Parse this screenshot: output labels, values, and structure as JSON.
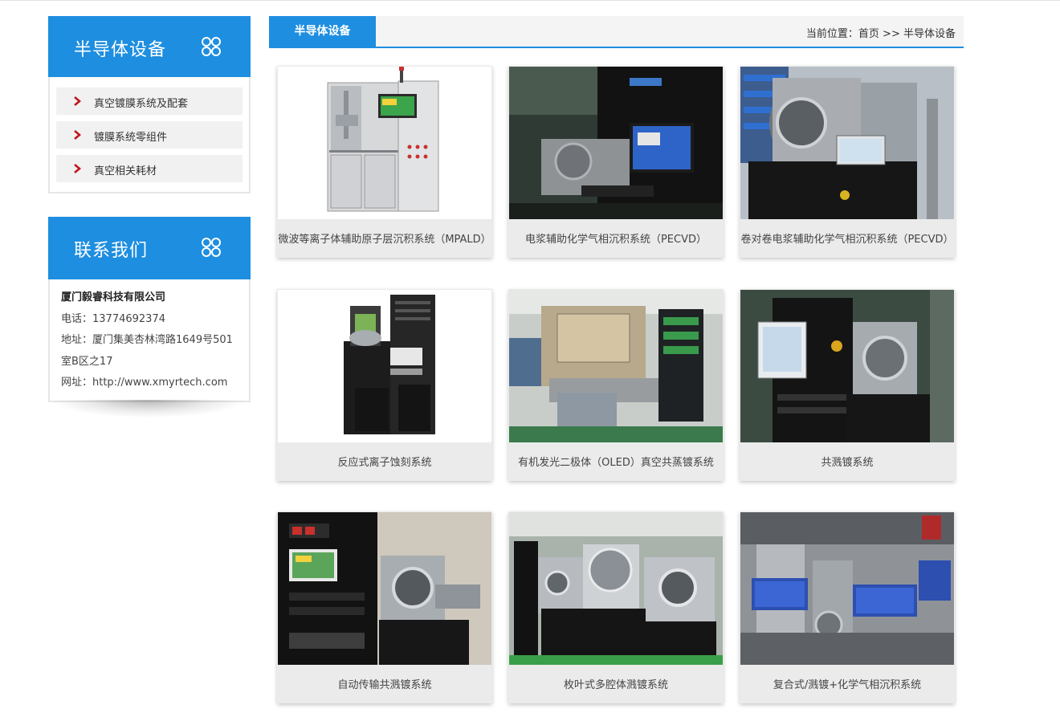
{
  "sidebar": {
    "products_title": "半导体设备",
    "categories": [
      {
        "label": "真空镀膜系统及配套"
      },
      {
        "label": "镀膜系统零组件"
      },
      {
        "label": "真空相关耗材"
      }
    ],
    "contact_title": "联系我们",
    "company": "厦门毅睿科技有限公司",
    "phone": "电话：13774692374",
    "address": "地址：厦门集美杏林湾路1649号501室B区之17",
    "website": "网址：http://www.xmyrtech.com"
  },
  "main": {
    "tab_title": "半导体设备",
    "breadcrumb": {
      "prefix": "当前位置：",
      "home": "首页",
      "separator": " >> ",
      "current": "半导体设备"
    }
  },
  "products": [
    {
      "name": "微波等离子体辅助原子层沉积系统（MPALD）"
    },
    {
      "name": "电浆辅助化学气相沉积系统（PECVD）"
    },
    {
      "name": "卷对卷电浆辅助化学气相沉积系统（PECVD）"
    },
    {
      "name": "反应式离子蚀刻系统"
    },
    {
      "name": "有机发光二极体（OLED）真空共蒸镀系统"
    },
    {
      "name": "共溅镀系统"
    },
    {
      "name": "自动传输共溅镀系统"
    },
    {
      "name": "枚叶式多腔体溅镀系统"
    },
    {
      "name": "复合式/溅镀+化学气相沉积系统"
    }
  ],
  "colors": {
    "accent": "#1e8ee0",
    "arrow": "#c0171d"
  }
}
